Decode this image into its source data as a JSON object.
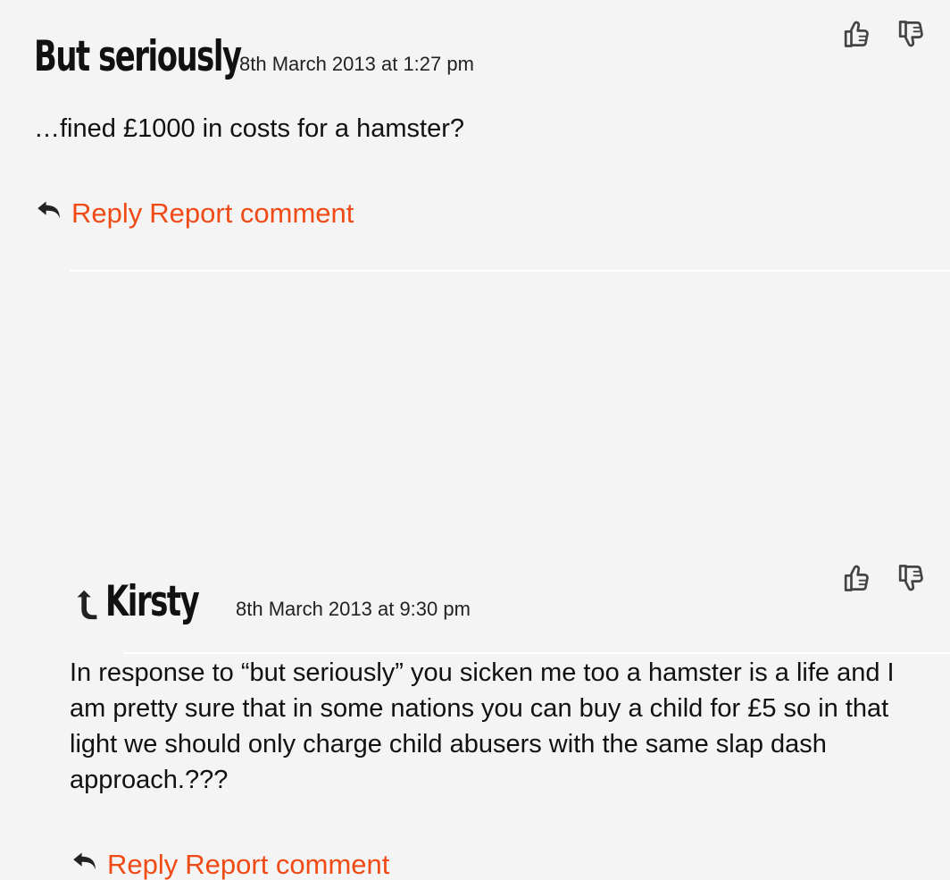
{
  "comments": [
    {
      "author": "But seriously",
      "timestamp": "8th March 2013 at 1:27 pm",
      "text": "…fined £1000 in costs for a hamster?",
      "actions": {
        "reply": "Reply",
        "report": "Report comment"
      },
      "icons": {
        "vote_up": "thumbs-up-icon",
        "vote_down": "thumbs-down-icon",
        "reply": "reply-icon"
      }
    },
    {
      "author": "Kirsty",
      "timestamp": "8th March 2013 at 9:30 pm",
      "text": "In response to “but seriously” you sicken me too a hamster is a life and I am pretty sure that in some nations you can buy a child for £5 so in that light we should only charge child abusers with the same slap dash approach.???",
      "actions": {
        "reply": "Reply",
        "report": "Report comment"
      },
      "icons": {
        "reply_indicator": "reply-indicator-icon",
        "vote_up": "thumbs-up-icon",
        "vote_down": "thumbs-down-icon",
        "reply": "reply-icon"
      }
    }
  ],
  "colors": {
    "background": "#f4f4f4",
    "link": "#f04a16",
    "text": "#111111"
  }
}
